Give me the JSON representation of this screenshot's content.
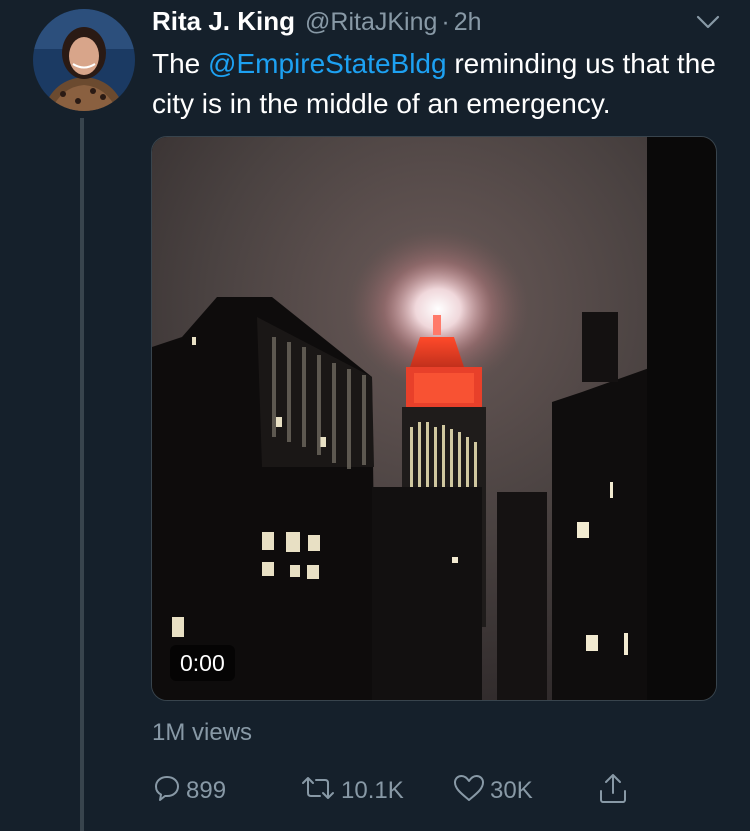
{
  "tweet": {
    "author_name": "Rita J. King",
    "handle": "@RitaJKing",
    "separator": "·",
    "time": "2h",
    "text_before": "The ",
    "mention": "@EmpireStateBldg",
    "text_after": " reminding us that the city is in the middle of an emergency."
  },
  "media": {
    "type": "video",
    "duration": "0:00",
    "views": "1M views"
  },
  "actions": {
    "reply_count": "899",
    "retweet_count": "10.1K",
    "like_count": "30K"
  },
  "icons": {
    "reply": "speech-bubble-icon",
    "retweet": "retweet-arrows-icon",
    "like": "heart-icon",
    "share": "share-upload-icon",
    "caret": "chevron-down-icon"
  },
  "colors": {
    "background": "#15202b",
    "link": "#1da1f2",
    "secondary_text": "#8899a6",
    "thread_line": "#38444d"
  }
}
